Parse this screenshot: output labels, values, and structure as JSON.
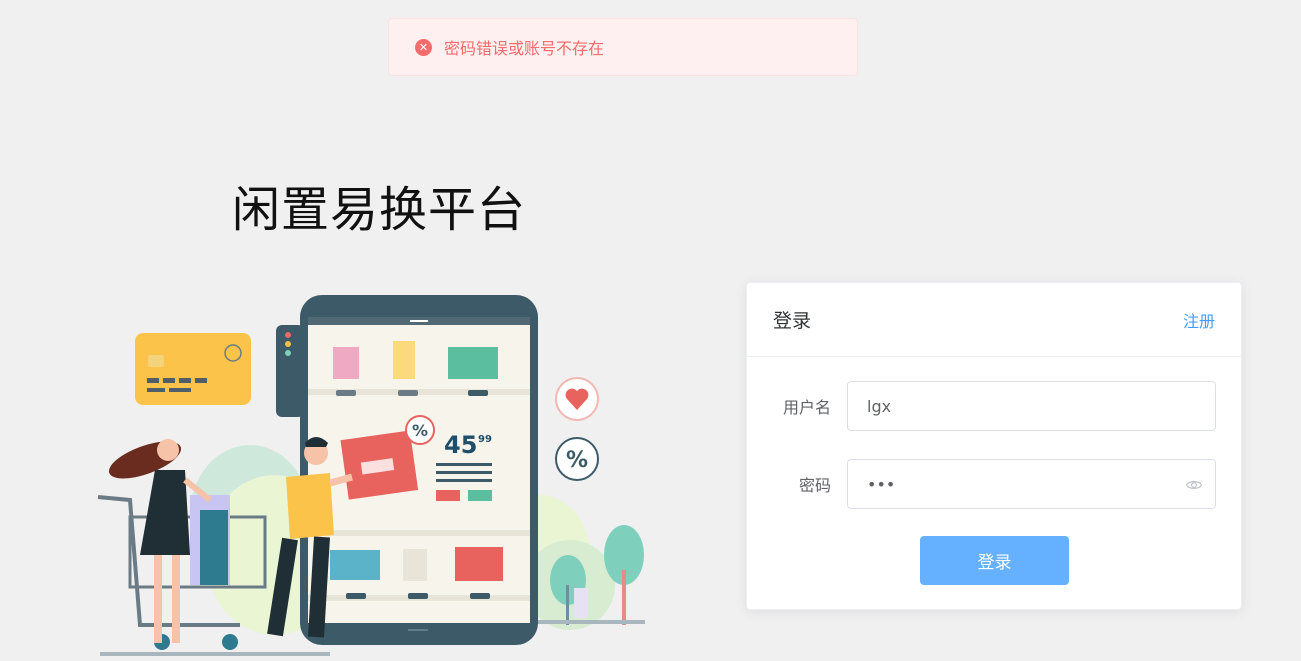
{
  "toast": {
    "icon": "error-circle-icon",
    "message": "密码错误或账号不存在",
    "color": "#f56c6c"
  },
  "app": {
    "title": "闲置易换平台"
  },
  "login_card": {
    "title": "登录",
    "register_link": "注册",
    "username": {
      "label": "用户名",
      "value": "lgx"
    },
    "password": {
      "label": "密码",
      "value": "•••",
      "toggle_icon": "eye-icon"
    },
    "submit_label": "登录",
    "accent_color": "#409eff"
  },
  "illustration": {
    "price_main": "45",
    "price_cents": "99",
    "percent_badge": "%",
    "icons": [
      "heart-icon",
      "percent-icon",
      "credit-card-icon",
      "shopping-cart-icon"
    ]
  }
}
